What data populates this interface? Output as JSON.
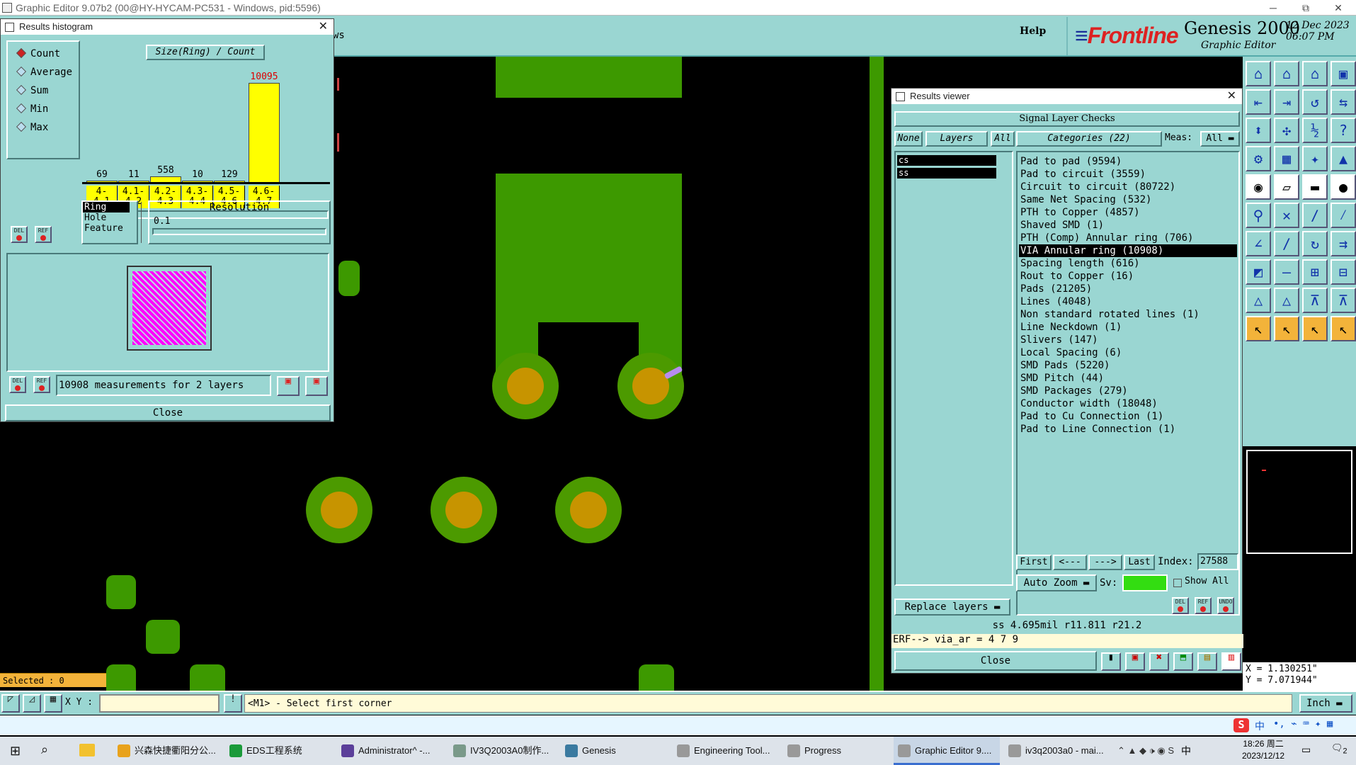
{
  "window": {
    "title": "Graphic Editor 9.07b2 (00@HY-HYCAM-PC531 - Windows, pid:5596)",
    "min_glyph": "─",
    "max_glyph": "⧉",
    "close_glyph": "✕"
  },
  "toolbar": {
    "help_label": "Help",
    "partial_label": "ws"
  },
  "logo": {
    "brand_main": "Frontline",
    "product": "Genesis 2000",
    "subtitle": "Graphic Editor",
    "date": "12 Dec 2023",
    "time": "06:07 PM"
  },
  "histogram": {
    "title": "Results histogram",
    "chart_title": "Size(Ring) / Count",
    "modes": [
      "Count",
      "Average",
      "Sum",
      "Min",
      "Max"
    ],
    "selected_mode": "Count",
    "categories": [
      "4-4.1",
      "4.1-4.2",
      "4.2-4.3",
      "4.3-4.4",
      "4.5-4.6",
      "4.6-4.7"
    ],
    "values": [
      69,
      11,
      558,
      10,
      129,
      10095
    ],
    "max_label": "10095",
    "types": [
      "Ring",
      "Hole",
      "Feature"
    ],
    "selected_type": "Ring",
    "resolution_label": "Resolution",
    "resolution_value": "0.1",
    "measurements_text": "10908 measurements for 2 layers",
    "close_label": "Close",
    "del_label": "DEL",
    "ref_label": "REF"
  },
  "results_viewer": {
    "title": "Results viewer",
    "header": "Signal Layer Checks",
    "none_label": "None",
    "layers_label": "Layers",
    "all_label": "All",
    "layers": [
      "cs",
      "ss"
    ],
    "categories_label": "Categories (22)",
    "meas_label": "Meas:",
    "meas_value": "All",
    "categories": [
      "Pad to pad (9594)",
      "Pad to circuit (3559)",
      "Circuit to circuit (80722)",
      "Same Net Spacing (532)",
      "PTH to Copper (4857)",
      "Shaved SMD (1)",
      "PTH (Comp) Annular ring (706)",
      "VIA Annular ring (10908)",
      "Spacing length (616)",
      "Rout to Copper (16)",
      "Pads (21205)",
      "Lines (4048)",
      "Non standard rotated lines (1)",
      "Line Neckdown (1)",
      "Slivers (147)",
      "Local Spacing (6)",
      "SMD Pads (5220)",
      "SMD Pitch (44)",
      "SMD Packages (279)",
      "Conductor width (18048)",
      "Pad to Cu Connection (1)",
      "Pad to Line Connection (1)"
    ],
    "selected_category": "VIA Annular ring (10908)",
    "first_label": "First",
    "prev_label": "<---",
    "next_label": "--->",
    "last_label": "Last",
    "index_label": "Index:",
    "index_value": "27588",
    "auto_zoom_label": "Auto Zoom",
    "sv_label": "Sv:",
    "show_all_label": "Show All",
    "replace_layers_label": "Replace layers",
    "measure_text": "ss 4.695mil  r11.811  r21.2",
    "erf_text": "ERF--> via_ar = 4 7 9",
    "close_label": "Close",
    "del_label": "DEL",
    "ref_label": "REF",
    "undo_label": "UNDO"
  },
  "status": {
    "selected": "Selected : 0",
    "xy_label": "X Y :",
    "prompt": "<M1> - Select first corner",
    "units": "Inch",
    "x_coord": "X = 1.130251\"",
    "y_coord": "Y = 7.071944\""
  },
  "taskbar": {
    "items": [
      {
        "label": "兴森快捷衢阳分公...",
        "color": "#e8a21c"
      },
      {
        "label": "EDS工程系统",
        "color": "#1a9a3a"
      },
      {
        "label": "Administrator^ -...",
        "color": "#5b3f9a"
      },
      {
        "label": "IV3Q2003A0制作...",
        "color": "#7a9a8a"
      },
      {
        "label": "Genesis",
        "color": "#3a7aa0"
      },
      {
        "label": "Engineering Tool...",
        "color": "#999999"
      },
      {
        "label": "Progress",
        "color": "#999999"
      },
      {
        "label": "Graphic Editor 9....",
        "color": "#999999"
      },
      {
        "label": "iv3q2003a0 - mai...",
        "color": "#999999"
      }
    ],
    "clock_time": "18:26 周二",
    "clock_date": "2023/12/12",
    "ime": "中",
    "notif_count": "2"
  },
  "colors": {
    "panel": "#9ad6d2",
    "copper": "#3d9900",
    "drill": "#c79400",
    "highlight": "#ffff00",
    "selected_bar": "#f3b33a"
  }
}
